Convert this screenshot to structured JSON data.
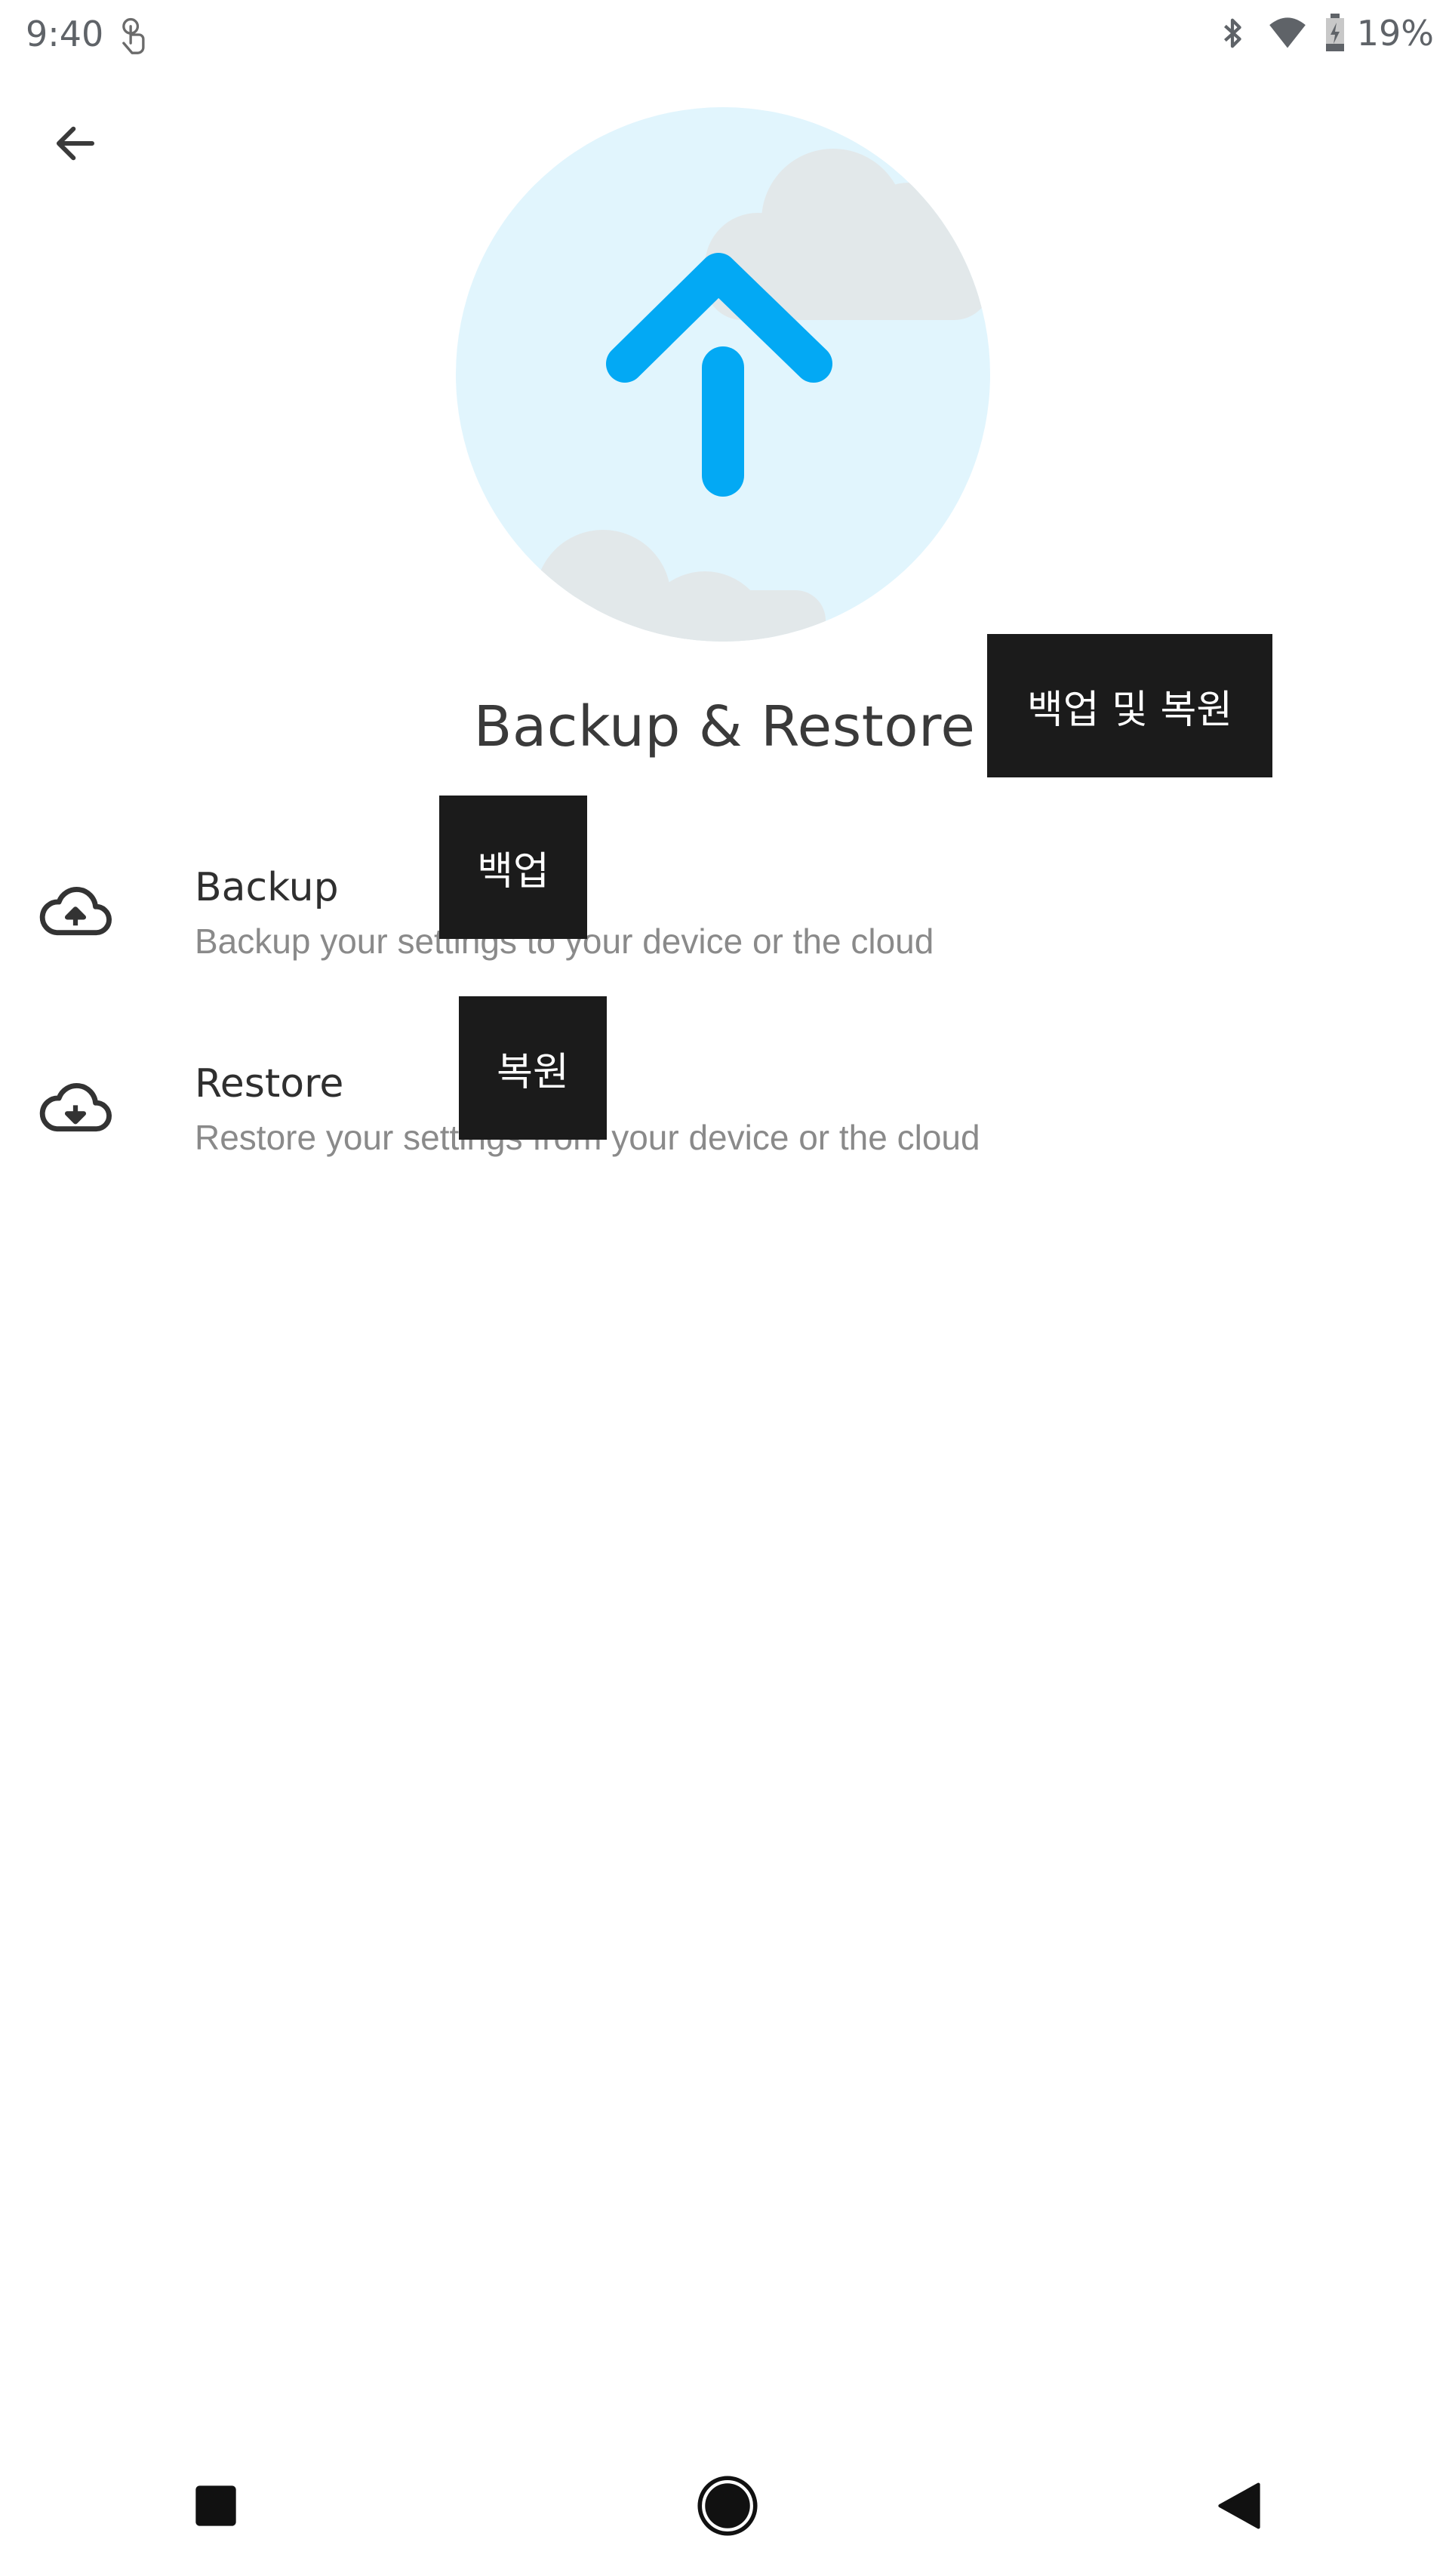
{
  "status_bar": {
    "time": "9:40",
    "battery_percent": "19%",
    "icons": [
      "touch-icon",
      "bluetooth-icon",
      "wifi-icon",
      "battery-icon"
    ]
  },
  "toolbar": {
    "back_icon": "arrow-back-icon"
  },
  "hero": {
    "icon": "upload-arrow-icon",
    "accent_color": "#03a9f4",
    "background_color": "#e1f5fd"
  },
  "page_title": "Backup & Restore",
  "items": [
    {
      "icon": "cloud-upload-icon",
      "title": "Backup",
      "subtitle": "Backup your settings to your device or the cloud"
    },
    {
      "icon": "cloud-download-icon",
      "title": "Restore",
      "subtitle": "Restore your settings from your device or the cloud"
    }
  ],
  "annotations": {
    "title": "백업 및 복원",
    "backup": "백업",
    "restore": "복원"
  },
  "nav_bar": {
    "icons": [
      "recents-icon",
      "home-icon",
      "back-triangle-icon"
    ]
  }
}
